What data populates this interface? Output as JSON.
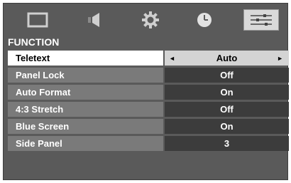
{
  "tabs": [
    {
      "icon": "picture-icon",
      "active": false
    },
    {
      "icon": "speaker-icon",
      "active": false
    },
    {
      "icon": "gear-icon",
      "active": false
    },
    {
      "icon": "clock-icon",
      "active": false
    },
    {
      "icon": "sliders-icon",
      "active": true
    }
  ],
  "section_title": "FUNCTION",
  "rows": [
    {
      "label": "Teletext",
      "value": "Auto",
      "selected": true
    },
    {
      "label": "Panel Lock",
      "value": "Off"
    },
    {
      "label": "Auto Format",
      "value": "On"
    },
    {
      "label": "4:3 Stretch",
      "value": "Off"
    },
    {
      "label": "Blue Screen",
      "value": "On"
    },
    {
      "label": "Side Panel",
      "value": "3"
    }
  ],
  "arrows": {
    "left": "◄",
    "right": "►"
  }
}
